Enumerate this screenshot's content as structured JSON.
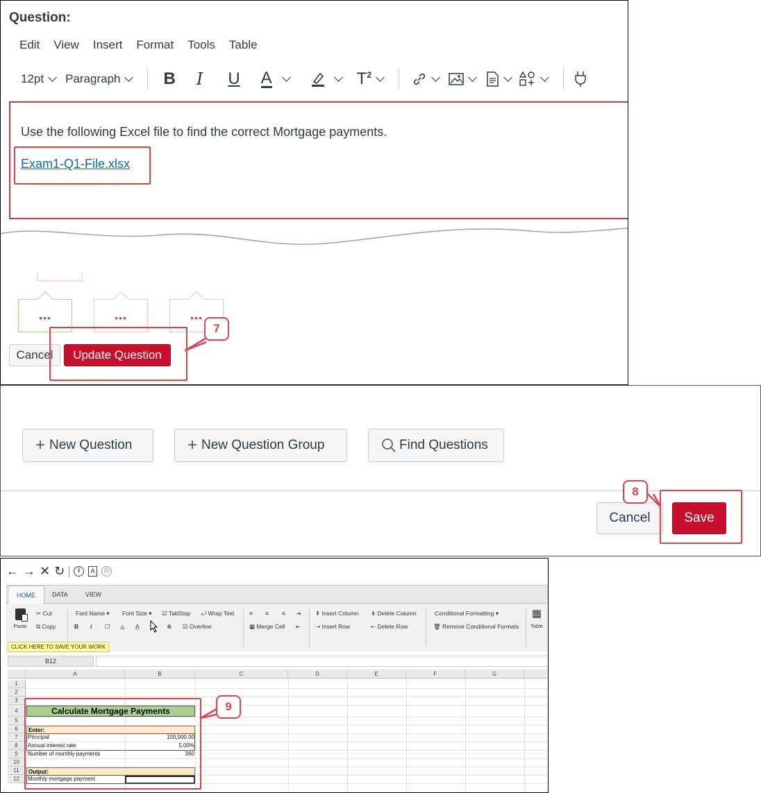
{
  "editor_panel": {
    "question_label": "Question:",
    "menu": [
      "Edit",
      "View",
      "Insert",
      "Format",
      "Tools",
      "Table"
    ],
    "font_size": "12pt",
    "block_format": "Paragraph",
    "toolbar_icons": [
      "bold-icon",
      "italic-icon",
      "underline-icon",
      "text-color-icon",
      "highlight-icon",
      "superscript-icon",
      "link-icon",
      "image-icon",
      "document-icon",
      "apps-icon",
      "plugin-icon"
    ],
    "body_text": "Use the following Excel file to find the correct Mortgage payments.",
    "link_text": "Exam1-Q1-File.xlsx",
    "cancel_label": "Cancel",
    "update_label": "Update Question",
    "callout": "7"
  },
  "quiz_panel": {
    "new_question": "New Question",
    "new_group": "New Question Group",
    "find_questions": "Find Questions",
    "cancel_label": "Cancel",
    "save_label": "Save",
    "callout": "8"
  },
  "sheet_panel": {
    "tabs": [
      "HOME",
      "DATA",
      "VIEW"
    ],
    "ribbon": {
      "paste": "Paste",
      "cut": "Cut",
      "copy": "Copy",
      "font_name": "Font Name",
      "font_size": "Font Size",
      "tabstop": "TabStop",
      "wrap_text": "Wrap Text",
      "overline": "Overline",
      "merge_cell": "Merge Cell",
      "insert_column": "Insert Column",
      "delete_column": "Delete Column",
      "insert_row": "Insert Row",
      "delete_row": "Delete Row",
      "conditional_formatting": "Conditional Formatting",
      "remove_conditional": "Remove Conditional Formats",
      "table": "Table"
    },
    "save_banner": "CLICK HERE TO SAVE YOUR WORK",
    "name_box": "B12",
    "columns": [
      "A",
      "B",
      "C",
      "D",
      "E",
      "F",
      "G"
    ],
    "rows": [
      "1",
      "2",
      "3",
      "4",
      "5",
      "6",
      "7",
      "8",
      "9",
      "10",
      "11",
      "12"
    ],
    "sheet_title": "Calculate Mortgage Payments",
    "enter_label": "Enter:",
    "principal_label": "Principal",
    "principal_value": "100,000.00",
    "rate_label": "Annual interest rate",
    "rate_value": "5.00%",
    "payments_label": "Number of monthly payments",
    "payments_value": "360",
    "output_label": "Output:",
    "monthly_label": "Monthly mortgage payment",
    "callout": "9"
  },
  "colors": {
    "accent_red": "#c8102e",
    "annotation_red": "#d9454f",
    "link_blue": "#0770a3"
  }
}
